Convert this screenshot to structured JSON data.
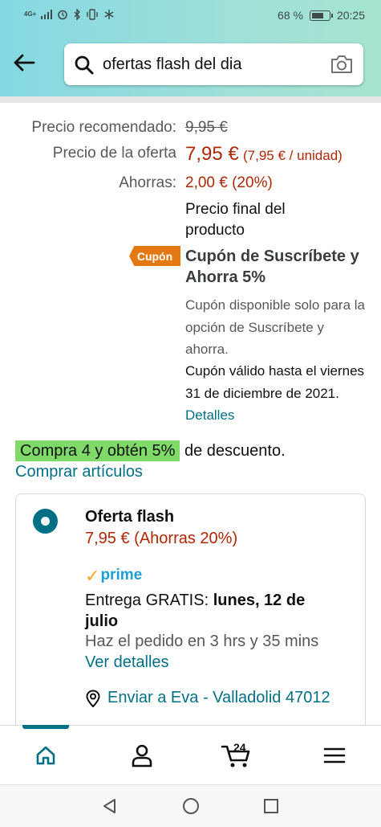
{
  "status_bar": {
    "network": "4G+",
    "battery_percent": "68 %",
    "battery_level": 0.68,
    "time": "20:25"
  },
  "search": {
    "value": "ofertas flash del dia"
  },
  "price": {
    "recommended_label": "Precio recomendado:",
    "recommended_value": "9,95 €",
    "offer_label": "Precio de la oferta",
    "offer_value": "7,95 €",
    "unit_price": "(7,95 € / unidad)",
    "savings_label": "Ahorras:",
    "savings_value": "2,00 € (20%)",
    "final_price_note": "Precio final del producto"
  },
  "coupon": {
    "badge": "Cupón",
    "title": "Cupón de Suscríbete y Ahorra 5%",
    "note": "Cupón disponible solo para la opción de Suscríbete y ahorra.",
    "valid_until": "Cupón válido hasta el viernes 31 de diciembre de 2021.",
    "details_link": "Detalles"
  },
  "promotion": {
    "highlight": "Compra 4 y obtén 5%",
    "suffix": "de descuento.",
    "buy_link": "Comprar artículos"
  },
  "offer": {
    "title": "Oferta flash",
    "price": "7,95 € (Ahorras 20%)",
    "prime_label": "prime",
    "delivery_prefix": "Entrega GRATIS:",
    "delivery_date": "lunes, 12 de julio",
    "order_by": "Haz el pedido en 3 hrs y 35 mins",
    "details_link": "Ver detalles",
    "ship_to": "Enviar a Eva - Valladolid 47012"
  },
  "bottom_nav": {
    "cart_count": "24"
  },
  "colors": {
    "accent": "#007185",
    "price_red": "#b12704",
    "coupon_orange": "#e47911",
    "promo_green": "#7fda6a",
    "prime_blue": "#1d9fd4"
  }
}
